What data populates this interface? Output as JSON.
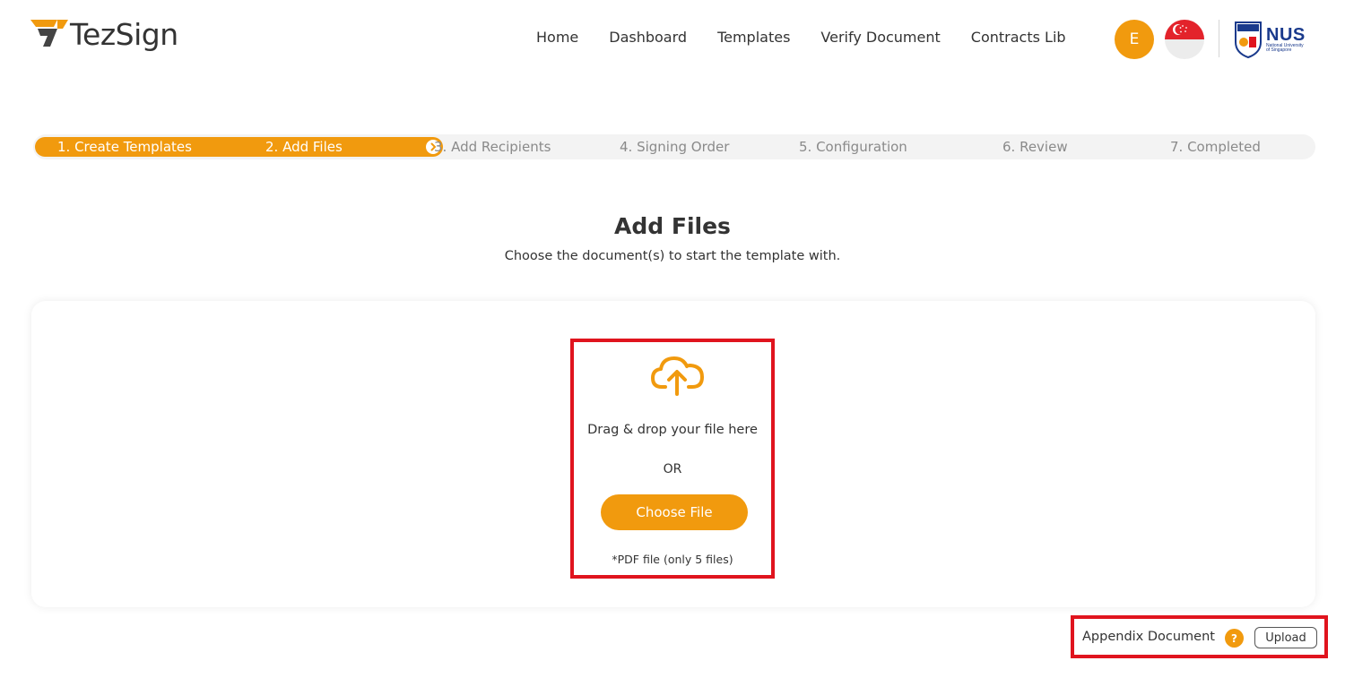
{
  "brand": {
    "name": "TezSign",
    "logo_icon": "tezsign-logo-icon",
    "accent_color": "#f19a0e"
  },
  "nav": {
    "items": [
      {
        "label": "Home"
      },
      {
        "label": "Dashboard"
      },
      {
        "label": "Templates"
      },
      {
        "label": "Verify Document"
      },
      {
        "label": "Contracts Lib"
      }
    ],
    "avatar_initial": "E",
    "flag_icon": "singapore-flag-icon",
    "org_logo": {
      "icon": "nus-shield-icon",
      "title": "NUS",
      "subtitle_line1": "National University",
      "subtitle_line2": "of Singapore"
    }
  },
  "stepper": {
    "steps": [
      {
        "label": "1. Create Templates",
        "state": "done"
      },
      {
        "label": "2. Add Files",
        "state": "current"
      },
      {
        "label": "3. Add Recipients",
        "state": "todo"
      },
      {
        "label": "4. Signing Order",
        "state": "todo"
      },
      {
        "label": "5. Configuration",
        "state": "todo"
      },
      {
        "label": "6. Review",
        "state": "todo"
      },
      {
        "label": "7. Completed",
        "state": "todo"
      }
    ],
    "progress_icon": "chevron-right-circle-icon"
  },
  "main": {
    "title": "Add Files",
    "subtitle": "Choose the document(s) to start the template with.",
    "dropzone": {
      "icon": "cloud-upload-icon",
      "drop_text": "Drag & drop your file here",
      "or_text": "OR",
      "button_label": "Choose File",
      "note": "*PDF file (only 5 files)"
    },
    "appendix": {
      "label": "Appendix Document",
      "help_icon": "?",
      "upload_label": "Upload"
    }
  }
}
